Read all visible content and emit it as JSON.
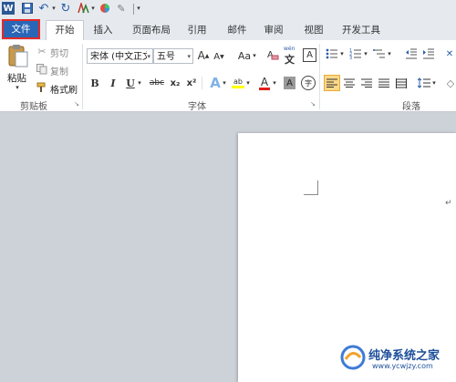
{
  "app": {
    "icon_letter": "W"
  },
  "tabs": {
    "file": "文件",
    "home": "开始",
    "insert": "插入",
    "page_layout": "页面布局",
    "references": "引用",
    "mailings": "邮件",
    "review": "审阅",
    "view": "视图",
    "developer": "开发工具"
  },
  "clipboard": {
    "paste": "粘贴",
    "cut": "剪切",
    "copy": "复制",
    "format_painter": "格式刷",
    "group_label": "剪贴板"
  },
  "font": {
    "font_name": "宋体 (中文正文)",
    "font_size": "五号",
    "aa_label": "Aa",
    "pinyin_label": "wén",
    "group_label": "字体",
    "bold": "B",
    "italic": "I",
    "underline": "U",
    "strike": "abc",
    "subscript": "x₂",
    "superscript": "x²",
    "font_color_letter": "A",
    "highlight_letter": "ab",
    "enclose_char": "字"
  },
  "paragraph": {
    "group_label": "段落"
  },
  "watermark": {
    "text": "纯净系统之家",
    "url": "www.ycwjzy.com"
  }
}
